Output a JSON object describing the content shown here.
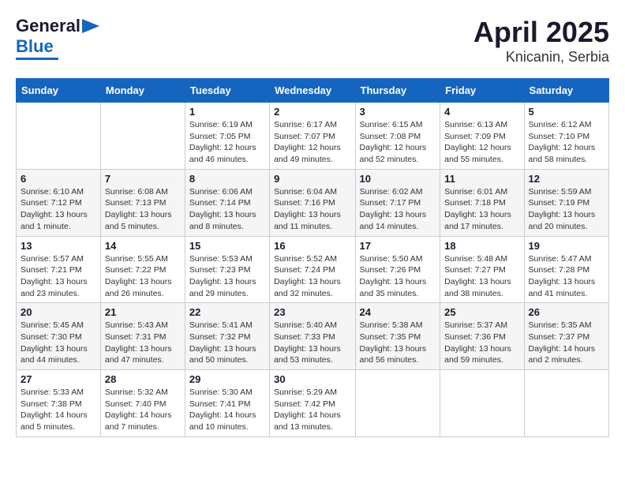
{
  "header": {
    "logo_line1": "General",
    "logo_line2": "Blue",
    "title": "April 2025",
    "subtitle": "Knicanin, Serbia"
  },
  "columns": [
    "Sunday",
    "Monday",
    "Tuesday",
    "Wednesday",
    "Thursday",
    "Friday",
    "Saturday"
  ],
  "weeks": [
    [
      {
        "day": "",
        "info": ""
      },
      {
        "day": "",
        "info": ""
      },
      {
        "day": "1",
        "info": "Sunrise: 6:19 AM\nSunset: 7:05 PM\nDaylight: 12 hours and 46 minutes."
      },
      {
        "day": "2",
        "info": "Sunrise: 6:17 AM\nSunset: 7:07 PM\nDaylight: 12 hours and 49 minutes."
      },
      {
        "day": "3",
        "info": "Sunrise: 6:15 AM\nSunset: 7:08 PM\nDaylight: 12 hours and 52 minutes."
      },
      {
        "day": "4",
        "info": "Sunrise: 6:13 AM\nSunset: 7:09 PM\nDaylight: 12 hours and 55 minutes."
      },
      {
        "day": "5",
        "info": "Sunrise: 6:12 AM\nSunset: 7:10 PM\nDaylight: 12 hours and 58 minutes."
      }
    ],
    [
      {
        "day": "6",
        "info": "Sunrise: 6:10 AM\nSunset: 7:12 PM\nDaylight: 13 hours and 1 minute."
      },
      {
        "day": "7",
        "info": "Sunrise: 6:08 AM\nSunset: 7:13 PM\nDaylight: 13 hours and 5 minutes."
      },
      {
        "day": "8",
        "info": "Sunrise: 6:06 AM\nSunset: 7:14 PM\nDaylight: 13 hours and 8 minutes."
      },
      {
        "day": "9",
        "info": "Sunrise: 6:04 AM\nSunset: 7:16 PM\nDaylight: 13 hours and 11 minutes."
      },
      {
        "day": "10",
        "info": "Sunrise: 6:02 AM\nSunset: 7:17 PM\nDaylight: 13 hours and 14 minutes."
      },
      {
        "day": "11",
        "info": "Sunrise: 6:01 AM\nSunset: 7:18 PM\nDaylight: 13 hours and 17 minutes."
      },
      {
        "day": "12",
        "info": "Sunrise: 5:59 AM\nSunset: 7:19 PM\nDaylight: 13 hours and 20 minutes."
      }
    ],
    [
      {
        "day": "13",
        "info": "Sunrise: 5:57 AM\nSunset: 7:21 PM\nDaylight: 13 hours and 23 minutes."
      },
      {
        "day": "14",
        "info": "Sunrise: 5:55 AM\nSunset: 7:22 PM\nDaylight: 13 hours and 26 minutes."
      },
      {
        "day": "15",
        "info": "Sunrise: 5:53 AM\nSunset: 7:23 PM\nDaylight: 13 hours and 29 minutes."
      },
      {
        "day": "16",
        "info": "Sunrise: 5:52 AM\nSunset: 7:24 PM\nDaylight: 13 hours and 32 minutes."
      },
      {
        "day": "17",
        "info": "Sunrise: 5:50 AM\nSunset: 7:26 PM\nDaylight: 13 hours and 35 minutes."
      },
      {
        "day": "18",
        "info": "Sunrise: 5:48 AM\nSunset: 7:27 PM\nDaylight: 13 hours and 38 minutes."
      },
      {
        "day": "19",
        "info": "Sunrise: 5:47 AM\nSunset: 7:28 PM\nDaylight: 13 hours and 41 minutes."
      }
    ],
    [
      {
        "day": "20",
        "info": "Sunrise: 5:45 AM\nSunset: 7:30 PM\nDaylight: 13 hours and 44 minutes."
      },
      {
        "day": "21",
        "info": "Sunrise: 5:43 AM\nSunset: 7:31 PM\nDaylight: 13 hours and 47 minutes."
      },
      {
        "day": "22",
        "info": "Sunrise: 5:41 AM\nSunset: 7:32 PM\nDaylight: 13 hours and 50 minutes."
      },
      {
        "day": "23",
        "info": "Sunrise: 5:40 AM\nSunset: 7:33 PM\nDaylight: 13 hours and 53 minutes."
      },
      {
        "day": "24",
        "info": "Sunrise: 5:38 AM\nSunset: 7:35 PM\nDaylight: 13 hours and 56 minutes."
      },
      {
        "day": "25",
        "info": "Sunrise: 5:37 AM\nSunset: 7:36 PM\nDaylight: 13 hours and 59 minutes."
      },
      {
        "day": "26",
        "info": "Sunrise: 5:35 AM\nSunset: 7:37 PM\nDaylight: 14 hours and 2 minutes."
      }
    ],
    [
      {
        "day": "27",
        "info": "Sunrise: 5:33 AM\nSunset: 7:38 PM\nDaylight: 14 hours and 5 minutes."
      },
      {
        "day": "28",
        "info": "Sunrise: 5:32 AM\nSunset: 7:40 PM\nDaylight: 14 hours and 7 minutes."
      },
      {
        "day": "29",
        "info": "Sunrise: 5:30 AM\nSunset: 7:41 PM\nDaylight: 14 hours and 10 minutes."
      },
      {
        "day": "30",
        "info": "Sunrise: 5:29 AM\nSunset: 7:42 PM\nDaylight: 14 hours and 13 minutes."
      },
      {
        "day": "",
        "info": ""
      },
      {
        "day": "",
        "info": ""
      },
      {
        "day": "",
        "info": ""
      }
    ]
  ]
}
